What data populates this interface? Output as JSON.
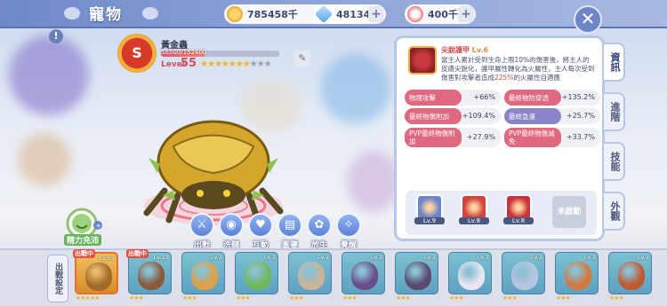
{
  "header": {
    "title": "寵物",
    "currencies": [
      {
        "name": "gold",
        "value": "785458千",
        "icon": "coin-icon",
        "color": "#f0b72a"
      },
      {
        "name": "diamond",
        "value": "48134",
        "icon": "diamond-icon",
        "color": "#6fb3f0"
      },
      {
        "name": "feather",
        "value": "400千",
        "icon": "feather-icon",
        "color": "#e47a7a"
      }
    ],
    "close_icon": "✕"
  },
  "pet": {
    "rank": "S",
    "name": "黃金蟲",
    "exp_text": "56500/152400",
    "exp_fraction": 0.37,
    "level_label": "Level",
    "level": "55",
    "stars_on": 7,
    "stars_total": 10
  },
  "actions": [
    {
      "label": "出戰",
      "icon": "swords-icon",
      "glyph": "⚔"
    },
    {
      "label": "洗髓",
      "icon": "refine-icon",
      "glyph": "◉"
    },
    {
      "label": "互動",
      "icon": "heart-icon",
      "glyph": "♥"
    },
    {
      "label": "圖鑒",
      "icon": "book-icon",
      "glyph": "▤"
    },
    {
      "label": "放生",
      "icon": "release-icon",
      "glyph": "✿"
    },
    {
      "label": "覺醒",
      "icon": "awaken-icon",
      "glyph": "✧"
    }
  ],
  "stamina_label": "精力充沛",
  "skill": {
    "name": "尖銳護甲",
    "level": "Lv.6",
    "desc_1": "當主人累計受到生命上限10%的傷害後，將主人的皮膚尖銳化，護甲屬性轉化為火屬性，主人每次受到傷害對攻擊者造成",
    "desc_hl": "225%",
    "desc_2": "的火屬性自適應"
  },
  "stats": [
    {
      "name": "物理攻擊",
      "value": "+66%",
      "color": "pink"
    },
    {
      "name": "最終物防穿透",
      "value": "+135.2%",
      "color": "pink"
    },
    {
      "name": "最終物傷附加",
      "value": "+109.4%",
      "color": "pink"
    },
    {
      "name": "最終急速",
      "value": "+25.7%",
      "color": "purple"
    },
    {
      "name": "PVP最終物傷附加",
      "value": "+27.9%",
      "color": "pink"
    },
    {
      "name": "PVP最終物傷減免",
      "value": "+33.7%",
      "color": "pink"
    }
  ],
  "skill_slots": [
    {
      "level": "Lv.9",
      "icon": "claw-skill-icon",
      "color": "#6c84c8"
    },
    {
      "level": "Lv.8",
      "icon": "fire-up-skill-icon",
      "color": "#d2453c"
    },
    {
      "level": "Lv.8",
      "icon": "fire-skill-icon",
      "color": "#c8343c"
    }
  ],
  "auto_label": "未啟動",
  "side_tabs": [
    {
      "label": "資訊",
      "active": true
    },
    {
      "label": "進階",
      "active": false
    },
    {
      "label": "技能",
      "active": false
    },
    {
      "label": "外觀",
      "active": false
    }
  ],
  "deploy_label": "出戰設定",
  "pet_list": [
    {
      "level": "Lv.55",
      "stars": "★★★★★",
      "tag": "出戰中",
      "color": "#a36a2a",
      "gold": true
    },
    {
      "level": "Lv.13",
      "stars": "★★★",
      "tag": "出戰中",
      "color": "#8a5a3a",
      "gold": false
    },
    {
      "level": "Lv.1",
      "stars": "★★★",
      "tag": "",
      "color": "#e0a045",
      "gold": false
    },
    {
      "level": "Lv.1",
      "stars": "★★★",
      "tag": "",
      "color": "#6fb85e",
      "gold": false
    },
    {
      "level": "Lv.1",
      "stars": "★★★",
      "tag": "",
      "color": "#c9b69a",
      "gold": false
    },
    {
      "level": "Lv.1",
      "stars": "★★★",
      "tag": "",
      "color": "#6a4e8a",
      "gold": false
    },
    {
      "level": "Lv.1",
      "stars": "★★★",
      "tag": "",
      "color": "#5a4a6e",
      "gold": false
    },
    {
      "level": "Lv.1",
      "stars": "★★★",
      "tag": "",
      "color": "#e8e6f0",
      "gold": false
    },
    {
      "level": "Lv.1",
      "stars": "★★★",
      "tag": "",
      "color": "#b7c5e0",
      "gold": false
    },
    {
      "level": "Lv.1",
      "stars": "★★★",
      "tag": "",
      "color": "#d07a40",
      "gold": false
    },
    {
      "level": "Lv.1",
      "stars": "★★★",
      "tag": "",
      "color": "#c05a30",
      "gold": false
    }
  ]
}
